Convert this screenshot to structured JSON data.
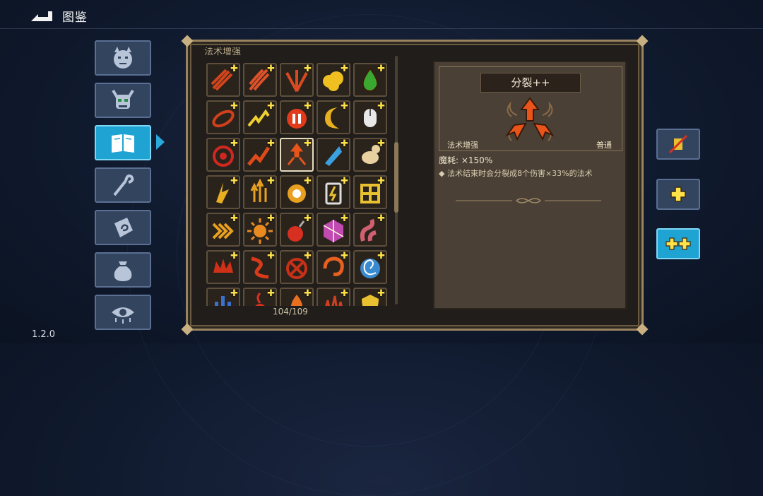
{
  "header": {
    "title": "图鉴"
  },
  "version": "1.2.0",
  "tabs": [
    {
      "id": "monsters",
      "icon": "demon-face-icon"
    },
    {
      "id": "bosses",
      "icon": "horned-skull-icon"
    },
    {
      "id": "codex",
      "icon": "open-book-icon",
      "active": true
    },
    {
      "id": "staffs",
      "icon": "magic-staff-icon"
    },
    {
      "id": "relics",
      "icon": "rune-stone-icon"
    },
    {
      "id": "items",
      "icon": "pouch-icon"
    },
    {
      "id": "curses",
      "icon": "evil-eye-icon"
    }
  ],
  "grid": {
    "category_label": "法术增强",
    "page_count": "104/109",
    "selected_index": 12,
    "cards": [
      {
        "icon": "triple-arrow-icon",
        "color": "#d2451c",
        "plus": true
      },
      {
        "icon": "claw-slash-icon",
        "color": "#e0522a",
        "plus": true
      },
      {
        "icon": "fan-arrows-icon",
        "color": "#d84a20",
        "plus": true
      },
      {
        "icon": "cloud-burst-icon",
        "color": "#f0c020",
        "plus": true
      },
      {
        "icon": "poison-drop-icon",
        "color": "#3aa830",
        "plus": true
      },
      {
        "icon": "orbit-arrow-icon",
        "color": "#d0401c",
        "plus": true
      },
      {
        "icon": "lightning-chain-icon",
        "color": "#f0d030",
        "plus": true
      },
      {
        "icon": "pause-orb-icon",
        "color": "#e23a1a",
        "plus": true
      },
      {
        "icon": "crescent-icon",
        "color": "#e8b020",
        "plus": true
      },
      {
        "icon": "mouse-click-icon",
        "color": "#e8e8e8",
        "plus": true
      },
      {
        "icon": "crosshair-icon",
        "color": "#d02820",
        "plus": true
      },
      {
        "icon": "zigzag-arrow-icon",
        "color": "#e04a1a",
        "plus": true
      },
      {
        "icon": "split-arrows-icon",
        "color": "#e8541a",
        "plus": true
      },
      {
        "icon": "ice-shard-icon",
        "color": "#3aa0e0",
        "plus": true
      },
      {
        "icon": "bone-worm-icon",
        "color": "#e8d0a0",
        "plus": true
      },
      {
        "icon": "bolt-wing-icon",
        "color": "#e8b020",
        "plus": true
      },
      {
        "icon": "rising-arrows-icon",
        "color": "#e8a020",
        "plus": true
      },
      {
        "icon": "target-ring-icon",
        "color": "#e8a020",
        "plus": true
      },
      {
        "icon": "battery-icon",
        "color": "#e8c030",
        "plus": true
      },
      {
        "icon": "lattice-icon",
        "color": "#e8c030",
        "plus": true
      },
      {
        "icon": "chevrons-icon",
        "color": "#e8a020",
        "plus": true
      },
      {
        "icon": "sun-spike-icon",
        "color": "#e88a20",
        "plus": true
      },
      {
        "icon": "bomb-icon",
        "color": "#d83020",
        "plus": true
      },
      {
        "icon": "crystal-cube-icon",
        "color": "#c04ab0",
        "plus": true
      },
      {
        "icon": "tentacle-icon",
        "color": "#d06070",
        "plus": true
      },
      {
        "icon": "crown-flower-icon",
        "color": "#d03018",
        "plus": true
      },
      {
        "icon": "swirl-claws-icon",
        "color": "#d83a1a",
        "plus": true
      },
      {
        "icon": "cross-spiral-icon",
        "color": "#c83018",
        "plus": true
      },
      {
        "icon": "hook-spiral-icon",
        "color": "#e86020",
        "plus": true
      },
      {
        "icon": "vortex-icon",
        "color": "#3a8ad0",
        "plus": true
      },
      {
        "icon": "tri-bars-icon",
        "color": "#3a70d0",
        "plus": true
      },
      {
        "icon": "ember-icon",
        "color": "#d83020",
        "plus": true
      },
      {
        "icon": "flame-burst-icon",
        "color": "#e87020",
        "plus": true
      },
      {
        "icon": "spikes-icon",
        "color": "#d04020",
        "plus": true
      },
      {
        "icon": "gold-shield-icon",
        "color": "#e8c030",
        "plus": true
      }
    ]
  },
  "detail": {
    "name": "分裂++",
    "category": "法术增强",
    "rarity": "普通",
    "mana_label": "魔耗: ×150%",
    "description": "◆ 法术结束时会分裂成8个伤害×33%的法术"
  },
  "right_buttons": [
    {
      "id": "none",
      "icon": "no-plus-icon",
      "active": false
    },
    {
      "id": "plus",
      "icon": "plus-icon",
      "active": false
    },
    {
      "id": "plusplus",
      "icon": "double-plus-icon",
      "active": true
    }
  ],
  "colors": {
    "tab_active": "#1fa3d3",
    "tab_inactive": "#33445f",
    "frame_gold": "#9a8460",
    "plus_yellow": "#ffe24a",
    "spell_orange": "#e8541a"
  }
}
